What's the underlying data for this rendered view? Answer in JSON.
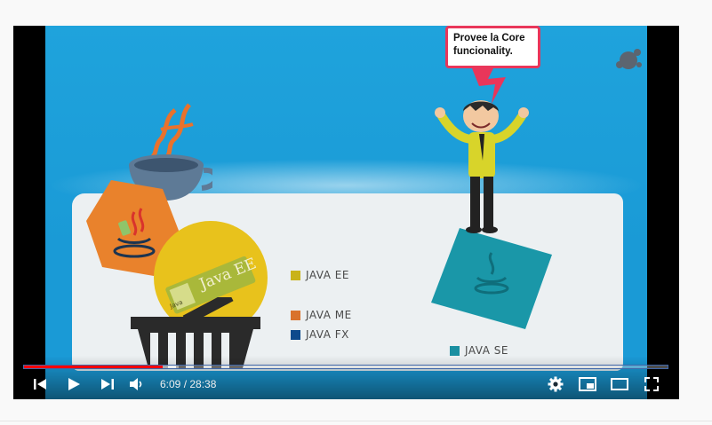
{
  "video": {
    "speech_bubble": "Provee la Core funcionality.",
    "java_ee_badge_text": "Java EE",
    "java_badge_small": "Java",
    "legend": [
      {
        "label": "JAVA EE",
        "color": "#c9b318"
      },
      {
        "label": "JAVA ME",
        "color": "#d9722c"
      },
      {
        "label": "JAVA FX",
        "color": "#0e4a8c"
      },
      {
        "label": "JAVA SE",
        "color": "#1a8fa1"
      }
    ]
  },
  "player": {
    "time_current": "6:09",
    "time_separator": " / ",
    "time_total": "28:38",
    "progress_played": 0.215,
    "progress_buffered": 0.24,
    "colors": {
      "played": "#ff0000",
      "background": "#000000"
    },
    "icons": [
      "previous-icon",
      "play-icon",
      "next-icon",
      "volume-icon",
      "settings-icon",
      "miniplayer-icon",
      "theater-icon",
      "fullscreen-icon"
    ]
  }
}
